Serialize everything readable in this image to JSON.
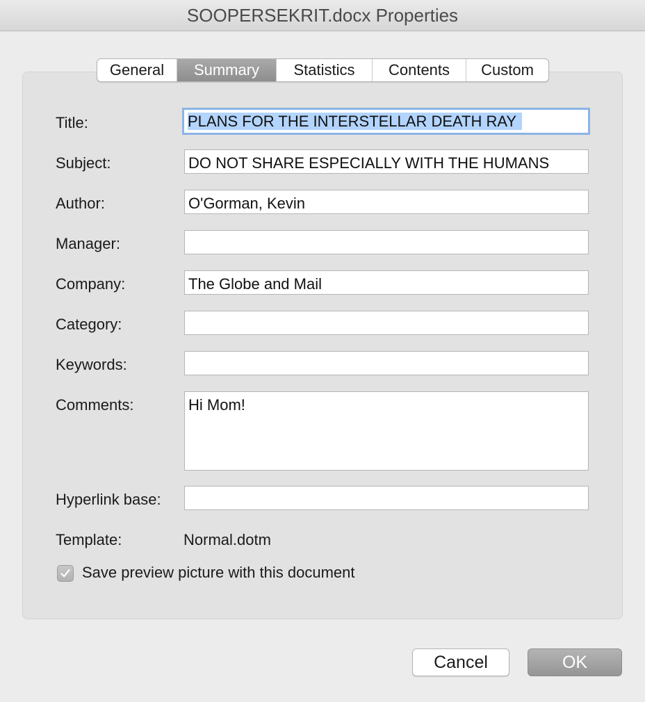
{
  "window": {
    "title": "SOOPERSEKRIT.docx Properties"
  },
  "tabs": [
    {
      "label": "General",
      "active": false
    },
    {
      "label": "Summary",
      "active": true
    },
    {
      "label": "Statistics",
      "active": false
    },
    {
      "label": "Contents",
      "active": false
    },
    {
      "label": "Custom",
      "active": false
    }
  ],
  "fields": {
    "title": {
      "label": "Title:",
      "value": "PLANS FOR THE INTERSTELLAR DEATH RAY"
    },
    "subject": {
      "label": "Subject:",
      "value": "DO NOT SHARE ESPECIALLY WITH THE HUMANS"
    },
    "author": {
      "label": "Author:",
      "value": "O'Gorman, Kevin"
    },
    "manager": {
      "label": "Manager:",
      "value": ""
    },
    "company": {
      "label": "Company:",
      "value": "The Globe and Mail"
    },
    "category": {
      "label": "Category:",
      "value": ""
    },
    "keywords": {
      "label": "Keywords:",
      "value": ""
    },
    "comments": {
      "label": "Comments:",
      "value": "Hi Mom!"
    },
    "hyperlink_base": {
      "label": "Hyperlink base:",
      "value": ""
    }
  },
  "template": {
    "label": "Template:",
    "value": "Normal.dotm"
  },
  "save_preview": {
    "label": "Save preview picture with this document",
    "checked": true
  },
  "buttons": {
    "cancel": "Cancel",
    "ok": "OK"
  },
  "colors": {
    "window_bg": "#ececec",
    "panel_bg": "#e2e2e2",
    "active_tab": "#9b9b9b",
    "focus_ring": "#8cb4e6",
    "selection": "#b3d4fc"
  }
}
